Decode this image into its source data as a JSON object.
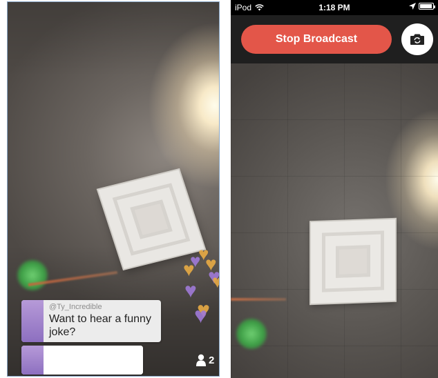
{
  "left_screen": {
    "comment": {
      "username": "@Ty_Incredible",
      "message": "Want to hear a funny joke?"
    },
    "compose": {
      "value": "",
      "placeholder": ""
    },
    "viewer_count": "2",
    "icons": {
      "viewers": "person-icon",
      "hearts": "heart-icon"
    }
  },
  "right_screen": {
    "status_bar": {
      "carrier": "iPod",
      "time": "1:18 PM"
    },
    "stop_broadcast_label": "Stop Broadcast",
    "icons": {
      "camera_switch": "camera-flip-icon",
      "wifi": "wifi-icon",
      "location": "location-arrow-icon",
      "battery": "battery-icon"
    }
  },
  "colors": {
    "stop_button": "#e35649",
    "header_bg": "#1f1f1f",
    "heart_orange": "#e5a945",
    "heart_purple": "#a07ad8"
  }
}
